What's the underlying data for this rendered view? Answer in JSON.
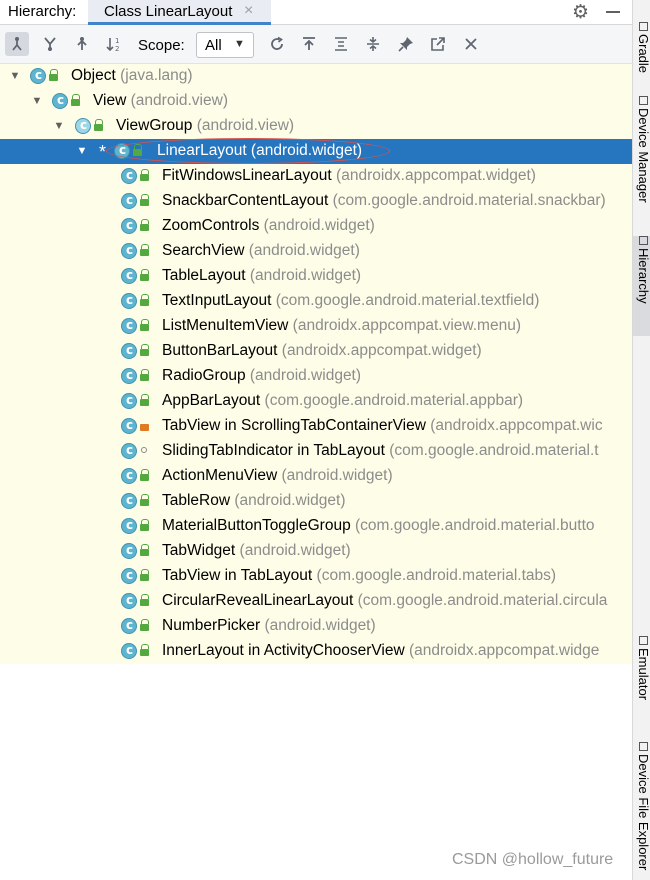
{
  "header": {
    "label": "Hierarchy:",
    "tab_label": "Class LinearLayout",
    "close_glyph": "×",
    "gear_icon": "gear-icon",
    "minimize_icon": "minimize-icon"
  },
  "toolbar": {
    "icons": [
      "subtypes-hierarchy-icon",
      "supertypes-hierarchy-icon",
      "class-hierarchy-icon",
      "sort-alphabetically-icon",
      "refresh-icon",
      "expand-all-icon",
      "collapse-all-icon",
      "pin-icon",
      "export-icon",
      "close-icon"
    ],
    "scope_label": "Scope:",
    "scope_value": "All"
  },
  "tree": {
    "rows": [
      {
        "name": "Object",
        "pkg": " (java.lang)",
        "arrow": "expanded",
        "vis": "open"
      },
      {
        "name": "View",
        "pkg": " (android.view)",
        "arrow": "expanded",
        "vis": "open"
      },
      {
        "name": "ViewGroup",
        "pkg": " (android.view)",
        "arrow": "expanded",
        "vis": "open",
        "abstract": true
      },
      {
        "name": "LinearLayout",
        "pkg": " (android.widget)",
        "arrow": "expanded",
        "vis": "open",
        "selected": true,
        "marker": "*"
      },
      {
        "name": "FitWindowsLinearLayout",
        "pkg": " (androidx.appcompat.widget)",
        "vis": "open"
      },
      {
        "name": "SnackbarContentLayout",
        "pkg": " (com.google.android.material.snackbar)",
        "vis": "open"
      },
      {
        "name": "ZoomControls",
        "pkg": " (android.widget)",
        "vis": "open"
      },
      {
        "name": "SearchView",
        "pkg": " (android.widget)",
        "vis": "open"
      },
      {
        "name": "TableLayout",
        "pkg": " (android.widget)",
        "vis": "open"
      },
      {
        "name": "TextInputLayout",
        "pkg": " (com.google.android.material.textfield)",
        "vis": "open"
      },
      {
        "name": "ListMenuItemView",
        "pkg": " (androidx.appcompat.view.menu)",
        "vis": "open"
      },
      {
        "name": "ButtonBarLayout",
        "pkg": " (androidx.appcompat.widget)",
        "vis": "open"
      },
      {
        "name": "RadioGroup",
        "pkg": " (android.widget)",
        "vis": "open"
      },
      {
        "name": "AppBarLayout",
        "pkg": " (com.google.android.material.appbar)",
        "vis": "open"
      },
      {
        "name": "TabView in ScrollingTabContainerView",
        "pkg": " (androidx.appcompat.wic",
        "vis": "private"
      },
      {
        "name": "SlidingTabIndicator in TabLayout",
        "pkg": " (com.google.android.material.t",
        "vis": "package"
      },
      {
        "name": "ActionMenuView",
        "pkg": " (android.widget)",
        "vis": "open"
      },
      {
        "name": "TableRow",
        "pkg": " (android.widget)",
        "vis": "open"
      },
      {
        "name": "MaterialButtonToggleGroup",
        "pkg": " (com.google.android.material.butto",
        "vis": "open"
      },
      {
        "name": "TabWidget",
        "pkg": " (android.widget)",
        "vis": "open"
      },
      {
        "name": "TabView in TabLayout",
        "pkg": " (com.google.android.material.tabs)",
        "vis": "open"
      },
      {
        "name": "CircularRevealLinearLayout",
        "pkg": " (com.google.android.material.circula",
        "vis": "open"
      },
      {
        "name": "NumberPicker",
        "pkg": " (android.widget)",
        "vis": "open"
      },
      {
        "name": "InnerLayout in ActivityChooserView",
        "pkg": " (androidx.appcompat.widge",
        "vis": "open"
      }
    ]
  },
  "side": {
    "items": [
      {
        "label": "Gradle",
        "icon": "gradle-icon"
      },
      {
        "label": "Device Manager",
        "icon": "device-manager-icon"
      },
      {
        "label": "Hierarchy",
        "icon": "hierarchy-icon",
        "active": true
      },
      {
        "label": "Emulator",
        "icon": "emulator-icon"
      },
      {
        "label": "Device File Explorer",
        "icon": "device-file-explorer-icon"
      }
    ]
  },
  "watermark": "CSDN @hollow_future"
}
